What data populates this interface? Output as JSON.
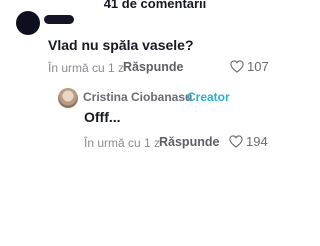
{
  "header": {
    "comments_count": "41 de comentarii"
  },
  "comments": [
    {
      "text": "Vlad nu spăla vasele?",
      "time": "În urmă cu 1 z",
      "reply_label": "Răspunde",
      "likes": "107"
    },
    {
      "author": "Cristina Ciobanasu",
      "separator": "·",
      "badge": "Creator",
      "text": "Offf...",
      "time": "În urmă cu 1 z",
      "reply_label": "Răspunde",
      "likes": "194",
      "colors": {
        "badge": "#20b4d6"
      }
    }
  ]
}
